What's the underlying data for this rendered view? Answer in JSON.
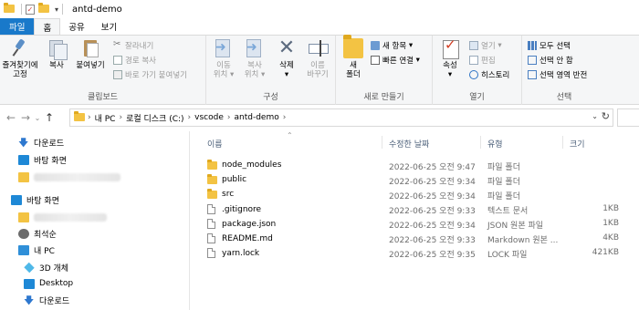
{
  "window": {
    "title": "antd-demo"
  },
  "tabs": [
    "파일",
    "홈",
    "공유",
    "보기"
  ],
  "ribbon": {
    "clipboard": {
      "pin_label_1": "즐겨찾기에",
      "pin_label_2": "고정",
      "copy": "복사",
      "paste": "붙여넣기",
      "cut": "잘라내기",
      "copy_path": "경로 복사",
      "paste_shortcut": "바로 가기 붙여넣기",
      "group": "클립보드"
    },
    "organize": {
      "move_1": "이동",
      "move_2": "위치",
      "copyto_1": "복사",
      "copyto_2": "위치",
      "delete": "삭제",
      "rename_1": "이름",
      "rename_2": "바꾸기",
      "group": "구성"
    },
    "new": {
      "new_folder_1": "새",
      "new_folder_2": "폴더",
      "new_item": "새 항목",
      "easy_access": "빠른 연결",
      "group": "새로 만들기"
    },
    "open": {
      "properties": "속성",
      "open": "열기",
      "edit": "편집",
      "history": "히스토리",
      "group": "열기"
    },
    "select": {
      "select_all": "모두 선택",
      "select_none": "선택 안 함",
      "invert": "선택 영역 반전",
      "group": "선택"
    }
  },
  "address": {
    "crumbs": [
      "내 PC",
      "로컬 디스크 (C:)",
      "vscode",
      "antd-demo"
    ]
  },
  "navpane": {
    "items": [
      "다운로드",
      "바탕 화면",
      "바탕 화면",
      "최석순",
      "내 PC",
      "3D 개체",
      "Desktop",
      "다운로드"
    ]
  },
  "filelist": {
    "headers": {
      "name": "이름",
      "date": "수정한 날짜",
      "type": "유형",
      "size": "크기"
    },
    "rows": [
      {
        "name": "node_modules",
        "date": "2022-06-25 오전 9:47",
        "type": "파일 폴더",
        "size": "",
        "kind": "folder"
      },
      {
        "name": "public",
        "date": "2022-06-25 오전 9:34",
        "type": "파일 폴더",
        "size": "",
        "kind": "folder"
      },
      {
        "name": "src",
        "date": "2022-06-25 오전 9:34",
        "type": "파일 폴더",
        "size": "",
        "kind": "folder"
      },
      {
        "name": ".gitignore",
        "date": "2022-06-25 오전 9:33",
        "type": "텍스트 문서",
        "size": "1KB",
        "kind": "file"
      },
      {
        "name": "package.json",
        "date": "2022-06-25 오전 9:34",
        "type": "JSON 원본 파일",
        "size": "1KB",
        "kind": "file"
      },
      {
        "name": "README.md",
        "date": "2022-06-25 오전 9:33",
        "type": "Markdown 원본 ...",
        "size": "4KB",
        "kind": "file"
      },
      {
        "name": "yarn.lock",
        "date": "2022-06-25 오전 9:35",
        "type": "LOCK 파일",
        "size": "421KB",
        "kind": "file"
      }
    ]
  },
  "colors": {
    "file_tab": "#1979ca",
    "folder": "#f3c343",
    "ribbon_bg": "#f5f6f7",
    "header_text": "#4c607a"
  }
}
